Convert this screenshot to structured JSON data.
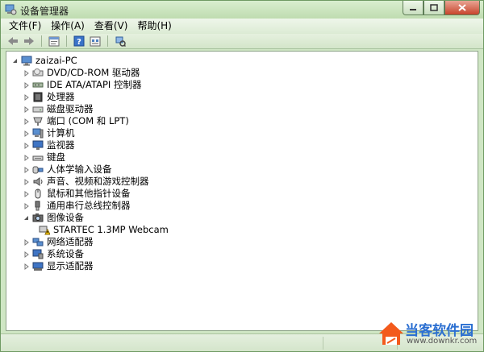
{
  "window": {
    "title": "设备管理器"
  },
  "menu": [
    {
      "label": "文件(F)"
    },
    {
      "label": "操作(A)"
    },
    {
      "label": "查看(V)"
    },
    {
      "label": "帮助(H)"
    }
  ],
  "toolbar": {
    "buttons": [
      "back-icon",
      "forward-icon",
      "properties-icon",
      "help-icon",
      "show-hidden-icon",
      "scan-hardware-icon"
    ]
  },
  "tree": {
    "root": "zaizai-PC",
    "items": [
      {
        "label": "DVD/CD-ROM 驱动器",
        "icon": "dvd-drive-icon",
        "expanded": false
      },
      {
        "label": "IDE ATA/ATAPI 控制器",
        "icon": "ide-controller-icon",
        "expanded": false
      },
      {
        "label": "处理器",
        "icon": "processor-icon",
        "expanded": false
      },
      {
        "label": "磁盘驱动器",
        "icon": "disk-drive-icon",
        "expanded": false
      },
      {
        "label": "端口 (COM 和 LPT)",
        "icon": "port-icon",
        "expanded": false
      },
      {
        "label": "计算机",
        "icon": "computer-icon",
        "expanded": false
      },
      {
        "label": "监视器",
        "icon": "monitor-icon",
        "expanded": false
      },
      {
        "label": "键盘",
        "icon": "keyboard-icon",
        "expanded": false
      },
      {
        "label": "人体学输入设备",
        "icon": "hid-icon",
        "expanded": false
      },
      {
        "label": "声音、视频和游戏控制器",
        "icon": "sound-icon",
        "expanded": false
      },
      {
        "label": "鼠标和其他指针设备",
        "icon": "mouse-icon",
        "expanded": false
      },
      {
        "label": "通用串行总线控制器",
        "icon": "usb-icon",
        "expanded": false
      },
      {
        "label": "图像设备",
        "icon": "imaging-device-icon",
        "expanded": true,
        "children": [
          {
            "label": "STARTEC 1.3MP Webcam",
            "icon": "webcam-warning-icon"
          }
        ]
      },
      {
        "label": "网络适配器",
        "icon": "network-adapter-icon",
        "expanded": false
      },
      {
        "label": "系统设备",
        "icon": "system-device-icon",
        "expanded": false
      },
      {
        "label": "显示适配器",
        "icon": "display-adapter-icon",
        "expanded": false
      }
    ]
  },
  "watermark": {
    "title": "当客软件园",
    "url": "www.downkr.com"
  },
  "colors": {
    "chrome": "#cfe6c4",
    "accent": "#2b6fd1",
    "warning": "#f2c200"
  }
}
